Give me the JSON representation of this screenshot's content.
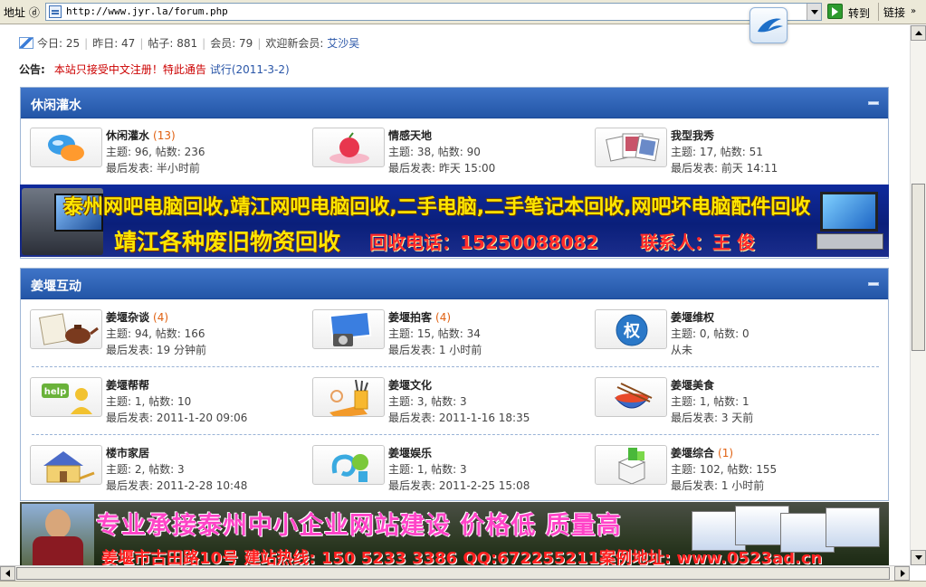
{
  "browser": {
    "address_label": "地址 ⓓ",
    "url": "http://www.jyr.la/forum.php",
    "go_label": "转到",
    "links_label": "链接"
  },
  "stats": {
    "today": "今日: 25",
    "yesterday": "昨日: 47",
    "posts": "帖子: 881",
    "members": "会员: 79",
    "welcome": "欢迎新会员:",
    "new_member": "艾沙吴"
  },
  "notice": {
    "label": "公告:",
    "text": "本站只接受中文注册！特此通告",
    "link": "试行(2011-3-2)"
  },
  "sections": [
    {
      "title": "休闲灌水",
      "forums": [
        {
          "name": "休闲灌水",
          "new": "(13)",
          "stat": "主题: 96, 帖数: 236",
          "last": "最后发表: 半小时前",
          "icon": "chat-bubbles-icon"
        },
        {
          "name": "情感天地",
          "new": "",
          "stat": "主题: 38, 帖数: 90",
          "last": "最后发表: 昨天 15:00",
          "icon": "heart-apple-icon"
        },
        {
          "name": "我型我秀",
          "new": "",
          "stat": "主题: 17, 帖数: 51",
          "last": "最后发表: 前天 14:11",
          "icon": "photos-icon"
        }
      ]
    },
    {
      "title": "姜堰互动",
      "forums": [
        {
          "name": "姜堰杂谈",
          "new": "(4)",
          "stat": "主题: 94, 帖数: 166",
          "last": "最后发表: 19 分钟前",
          "icon": "teapot-icon"
        },
        {
          "name": "姜堰拍客",
          "new": "(4)",
          "stat": "主题: 15, 帖数: 34",
          "last": "最后发表: 1 小时前",
          "icon": "camera-icon"
        },
        {
          "name": "姜堰维权",
          "new": "",
          "stat": "主题: 0, 帖数: 0",
          "last": "从未",
          "icon": "rights-icon"
        },
        {
          "name": "姜堰帮帮",
          "new": "",
          "stat": "主题: 1, 帖数: 10",
          "last": "最后发表: 2011-1-20 09:06",
          "icon": "help-icon"
        },
        {
          "name": "姜堰文化",
          "new": "",
          "stat": "主题: 3, 帖数: 3",
          "last": "最后发表: 2011-1-16 18:35",
          "icon": "pens-icon"
        },
        {
          "name": "姜堰美食",
          "new": "",
          "stat": "主题: 1, 帖数: 1",
          "last": "最后发表: 3 天前",
          "icon": "food-bowl-icon"
        },
        {
          "name": "楼市家居",
          "new": "",
          "stat": "主题: 2, 帖数: 3",
          "last": "最后发表: 2011-2-28 10:48",
          "icon": "house-icon"
        },
        {
          "name": "姜堰娱乐",
          "new": "",
          "stat": "主题: 1, 帖数: 3",
          "last": "最后发表: 2011-2-25 15:08",
          "icon": "music-icon"
        },
        {
          "name": "姜堰综合",
          "new": "(1)",
          "stat": "主题: 102, 帖数: 155",
          "last": "最后发表: 1 小时前",
          "icon": "box-icon"
        }
      ]
    }
  ],
  "rights_glyph": "权",
  "help_glyph": "help",
  "banner1": {
    "line1": "泰州网吧电脑回收,靖江网吧电脑回收,二手电脑,二手笔记本回收,网吧坏电脑配件回收",
    "line2": "靖江各种废旧物资回收",
    "phone": "回收电话：15250088082",
    "contact": "联系人：王 俊"
  },
  "banner2": {
    "line1": "专业承接泰州中小企业网站建设 价格低 质量高",
    "line2": "姜堰市古田路10号 建站热线: 150 5233 3386 QQ:672255211案例地址: www.0523ad.cn"
  },
  "colors": {
    "header_blue": "#2356a7",
    "new_count": "#e06010",
    "notice_red": "#cc0000",
    "link_blue": "#2a56a8"
  }
}
